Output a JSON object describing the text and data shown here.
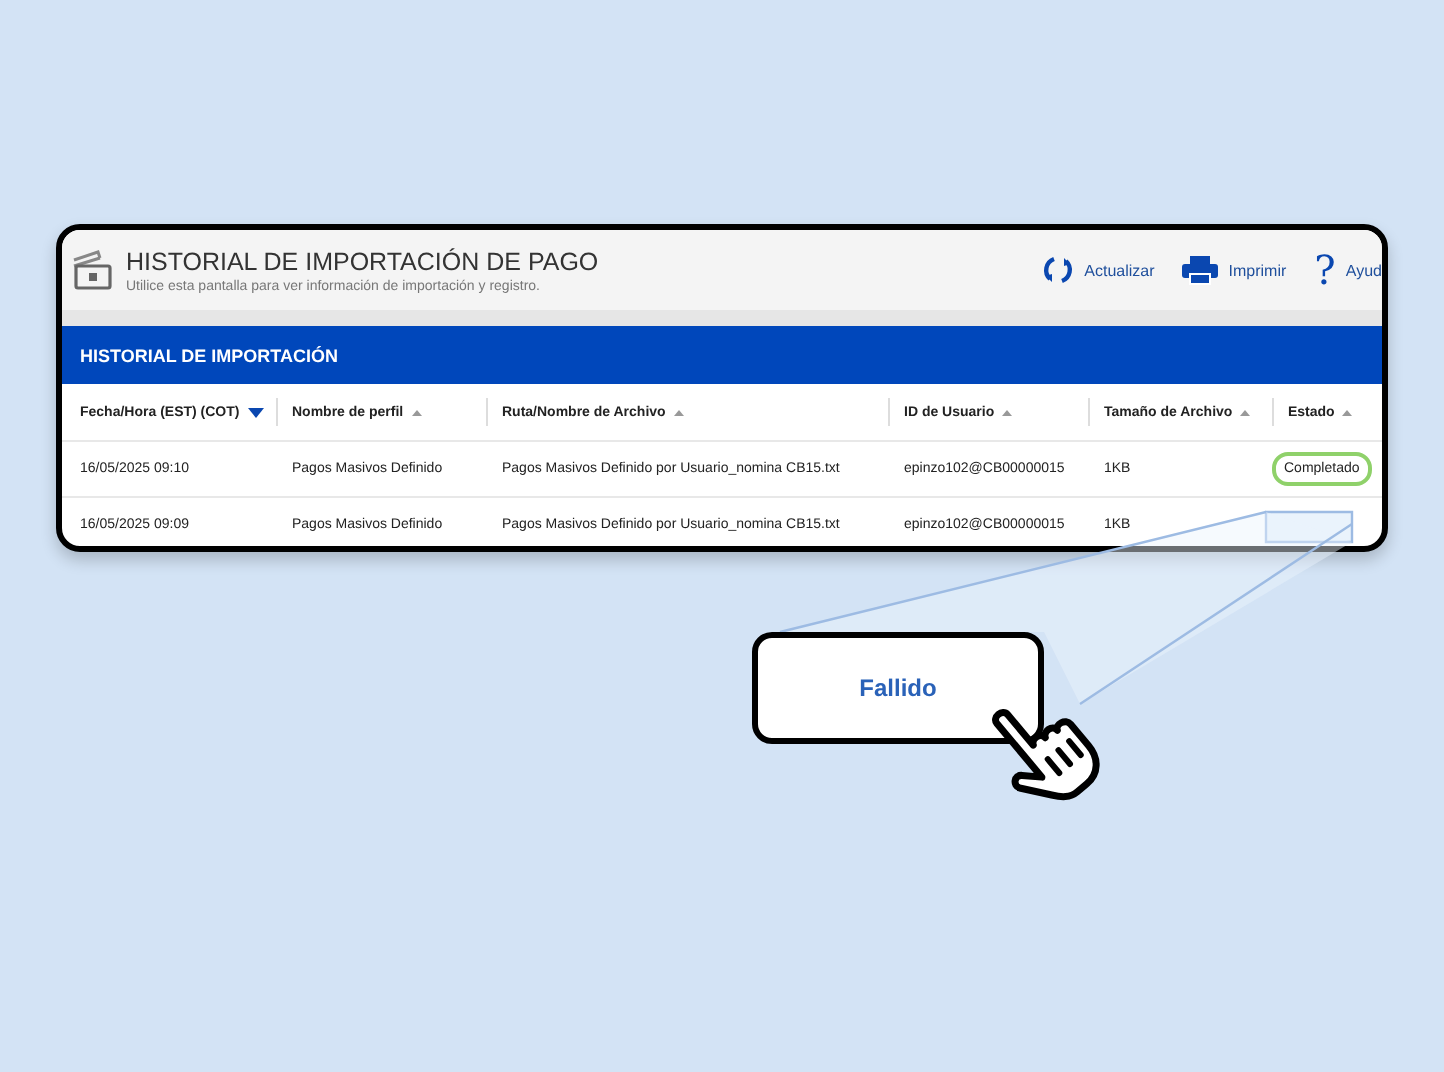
{
  "header": {
    "title": "HISTORIAL DE IMPORTACIÓN DE PAGO",
    "subtitle": "Utilice esta pantalla para ver información de importación y registro.",
    "actions": [
      {
        "kind": "refresh",
        "label": "Actualizar"
      },
      {
        "kind": "print",
        "label": "Imprimir"
      },
      {
        "kind": "help",
        "glyph": "?",
        "label": "Ayud"
      }
    ]
  },
  "section": {
    "title": "HISTORIAL DE IMPORTACIÓN"
  },
  "table": {
    "columns": [
      {
        "label": "Fecha/Hora (EST) (COT)",
        "sorted": true
      },
      {
        "label": "Nombre de perfil",
        "sorted": false
      },
      {
        "label": "Ruta/Nombre de Archivo",
        "sorted": false
      },
      {
        "label": "ID de Usuario",
        "sorted": false
      },
      {
        "label": "Tamaño de Archivo",
        "sorted": false
      },
      {
        "label": "Estado",
        "sorted": false
      }
    ],
    "rows": [
      {
        "cells": [
          "16/05/2025 09:10",
          "Pagos Masivos Definido",
          "Pagos Masivos Definido por Usuario_nomina CB15.txt",
          "epinzo102@CB00000015",
          "1KB"
        ],
        "status": {
          "text": "Completado",
          "ringed": true
        }
      },
      {
        "cells": [
          "16/05/2025 09:09",
          "Pagos Masivos Definido",
          "Pagos Masivos Definido por Usuario_nomina CB15.txt",
          "epinzo102@CB00000015",
          "1KB"
        ]
      }
    ]
  },
  "callout": {
    "text": "Fallido"
  }
}
